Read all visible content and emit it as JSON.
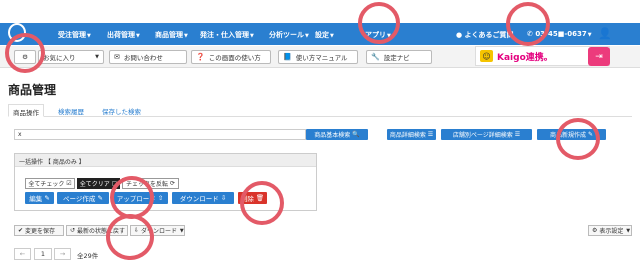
{
  "nav": {
    "items": [
      {
        "label": "受注管理"
      },
      {
        "label": "出荷管理"
      },
      {
        "label": "商品管理"
      },
      {
        "label": "発注・仕入管理"
      },
      {
        "label": "分析ツール"
      },
      {
        "label": "設定"
      },
      {
        "label": "アプリ"
      }
    ],
    "help": "よくあるご質問",
    "phone": "03-45■-0637"
  },
  "toolbar": {
    "favorites": "お気に入り",
    "contact": "お問い合わせ",
    "how_to": "この画面の使い方",
    "manual": "使い方マニュアル",
    "navi": "設定ナビ",
    "kaigo": "Kaigo連携。"
  },
  "page": {
    "title": "商品管理",
    "tabs": [
      "商品操作",
      "検索履歴",
      "保存した検索"
    ]
  },
  "search": {
    "value": "x",
    "basic": "商品基本検索",
    "detail": "商品詳細検索",
    "store_page": "店舗別ページ詳細検索",
    "create": "商品新規作成"
  },
  "bulk": {
    "header": "一括操作 【 商品のみ 】",
    "check_all": "全てチェック",
    "clear_all": "全てクリア",
    "invert": "チェックを反転",
    "edit": "編集",
    "page_create": "ページ作成",
    "upload": "アップロード",
    "download": "ダウンロード",
    "delete": "削除"
  },
  "actions": {
    "save_changes": "変更を保存",
    "revert": "最新の状態に戻す",
    "download": "ダウンロード",
    "display_settings": "表示設定"
  },
  "pagination": {
    "page": "1",
    "total": "全29件"
  },
  "colors": {
    "nav": "#2a7fd0",
    "button_blue": "#2a7fd0",
    "delete_red": "#d9342b",
    "overlay_ring": "#e35a67",
    "kaigo_pink": "#e4007f"
  }
}
